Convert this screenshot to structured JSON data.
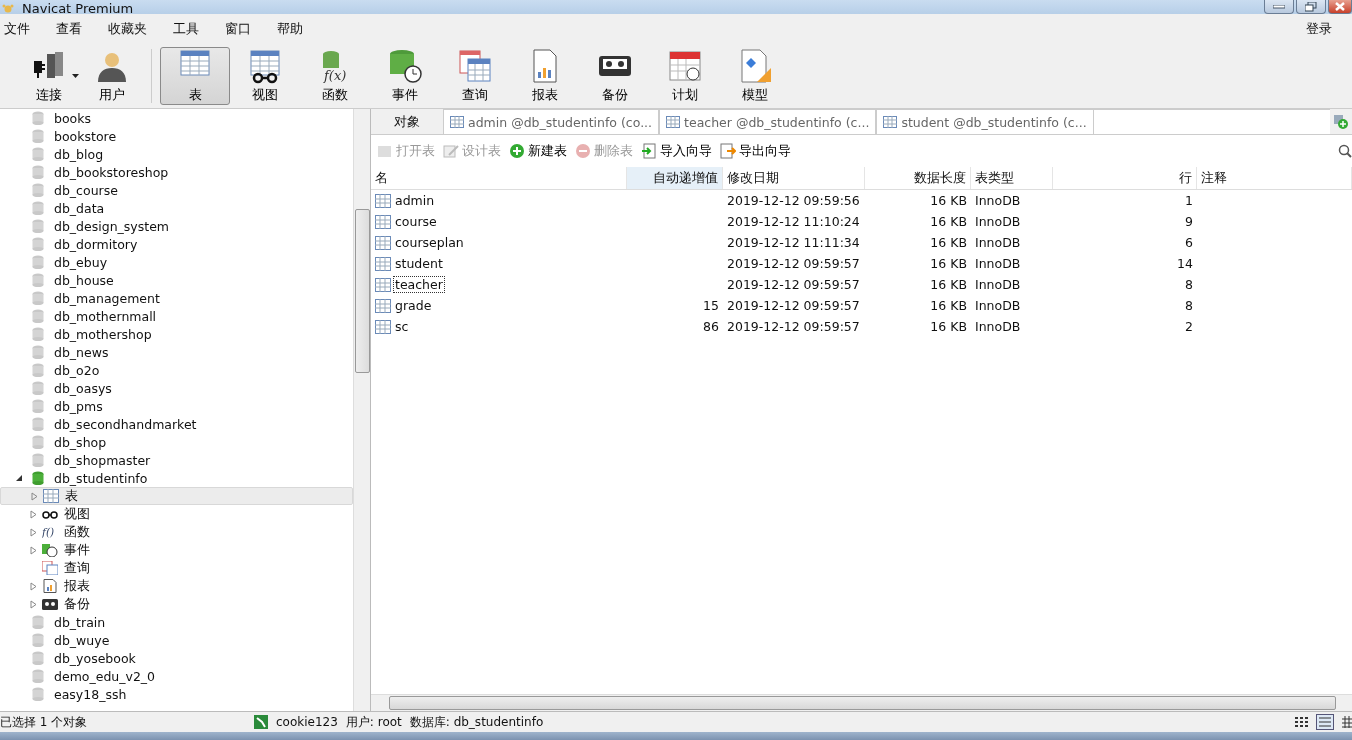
{
  "window": {
    "title": "Navicat Premium"
  },
  "menu": [
    "文件",
    "查看",
    "收藏夹",
    "工具",
    "窗口",
    "帮助"
  ],
  "login": "登录",
  "toolbar": [
    {
      "kind": "connection",
      "label": "连接",
      "selected": false
    },
    {
      "kind": "user",
      "label": "用户",
      "selected": false
    },
    {
      "kind": "table",
      "label": "表",
      "selected": true
    },
    {
      "kind": "view",
      "label": "视图",
      "selected": false
    },
    {
      "kind": "function",
      "label": "函数",
      "glyph": "f(x)",
      "selected": false
    },
    {
      "kind": "event",
      "label": "事件",
      "selected": false
    },
    {
      "kind": "query",
      "label": "查询",
      "selected": false
    },
    {
      "kind": "report",
      "label": "报表",
      "selected": false
    },
    {
      "kind": "backup",
      "label": "备份",
      "selected": false
    },
    {
      "kind": "schedule",
      "label": "计划",
      "selected": false
    },
    {
      "kind": "model",
      "label": "模型",
      "selected": false
    }
  ],
  "tree": [
    {
      "name": "books",
      "expanded": false
    },
    {
      "name": "bookstore",
      "expanded": false
    },
    {
      "name": "db_blog",
      "expanded": false
    },
    {
      "name": "db_bookstoreshop",
      "expanded": false
    },
    {
      "name": "db_course",
      "expanded": false
    },
    {
      "name": "db_data",
      "expanded": false
    },
    {
      "name": "db_design_system",
      "expanded": false
    },
    {
      "name": "db_dormitory",
      "expanded": false
    },
    {
      "name": "db_ebuy",
      "expanded": false
    },
    {
      "name": "db_house",
      "expanded": false
    },
    {
      "name": "db_management",
      "expanded": false
    },
    {
      "name": "db_mothernmall",
      "expanded": false
    },
    {
      "name": "db_mothershop",
      "expanded": false
    },
    {
      "name": "db_news",
      "expanded": false
    },
    {
      "name": "db_o2o",
      "expanded": false
    },
    {
      "name": "db_oasys",
      "expanded": false
    },
    {
      "name": "db_pms",
      "expanded": false
    },
    {
      "name": "db_secondhandmarket",
      "expanded": false
    },
    {
      "name": "db_shop",
      "expanded": false
    },
    {
      "name": "db_shopmaster",
      "expanded": false
    },
    {
      "name": "db_studentinfo",
      "expanded": true,
      "children": [
        {
          "kind": "table",
          "name": "表",
          "expandable": true,
          "selected": true
        },
        {
          "kind": "view",
          "name": "视图",
          "expandable": true,
          "selected": false
        },
        {
          "kind": "function",
          "name": "函数",
          "glyph": "f()",
          "expandable": true,
          "selected": false
        },
        {
          "kind": "event",
          "name": "事件",
          "expandable": true,
          "selected": false
        },
        {
          "kind": "query",
          "name": "查询",
          "expandable": false,
          "selected": false
        },
        {
          "kind": "report",
          "name": "报表",
          "expandable": true,
          "selected": false
        },
        {
          "kind": "backup",
          "name": "备份",
          "expandable": true,
          "selected": false
        }
      ]
    },
    {
      "name": "db_train",
      "expanded": false
    },
    {
      "name": "db_wuye",
      "expanded": false
    },
    {
      "name": "db_yosebook",
      "expanded": false
    },
    {
      "name": "demo_edu_v2_0",
      "expanded": false
    },
    {
      "name": "easy18_ssh",
      "expanded": false
    }
  ],
  "tabs": [
    {
      "label": "对象",
      "kind": "objects",
      "selected": true
    },
    {
      "label": "admin @db_studentinfo (co...",
      "kind": "table",
      "selected": false
    },
    {
      "label": "teacher @db_studentinfo (c...",
      "kind": "table",
      "selected": false
    },
    {
      "label": "student @db_studentinfo (c...",
      "kind": "table",
      "selected": false
    }
  ],
  "actions": [
    {
      "kind": "open",
      "label": "打开表",
      "disabled": true
    },
    {
      "kind": "design",
      "label": "设计表",
      "disabled": true
    },
    {
      "kind": "new",
      "label": "新建表",
      "disabled": false
    },
    {
      "kind": "delete",
      "label": "删除表",
      "disabled": true
    },
    {
      "kind": "import",
      "label": "导入向导",
      "disabled": false
    },
    {
      "kind": "export",
      "label": "导出向导",
      "disabled": false
    }
  ],
  "table": {
    "columns": [
      "名",
      "自动递增值",
      "修改日期",
      "数据长度",
      "表类型",
      "行",
      "注释"
    ],
    "rows": [
      {
        "name": "admin",
        "auto_increment": "",
        "modified": "2019-12-12 09:59:56",
        "size": "16 KB",
        "type": "InnoDB",
        "rows": "1",
        "focused": false
      },
      {
        "name": "course",
        "auto_increment": "",
        "modified": "2019-12-12 11:10:24",
        "size": "16 KB",
        "type": "InnoDB",
        "rows": "9",
        "focused": false
      },
      {
        "name": "courseplan",
        "auto_increment": "",
        "modified": "2019-12-12 11:11:34",
        "size": "16 KB",
        "type": "InnoDB",
        "rows": "6",
        "focused": false
      },
      {
        "name": "student",
        "auto_increment": "",
        "modified": "2019-12-12 09:59:57",
        "size": "16 KB",
        "type": "InnoDB",
        "rows": "14",
        "focused": false
      },
      {
        "name": "teacher",
        "auto_increment": "",
        "modified": "2019-12-12 09:59:57",
        "size": "16 KB",
        "type": "InnoDB",
        "rows": "8",
        "focused": true
      },
      {
        "name": "grade",
        "auto_increment": "15",
        "modified": "2019-12-12 09:59:57",
        "size": "16 KB",
        "type": "InnoDB",
        "rows": "8",
        "focused": false
      },
      {
        "name": "sc",
        "auto_increment": "86",
        "modified": "2019-12-12 09:59:57",
        "size": "16 KB",
        "type": "InnoDB",
        "rows": "2",
        "focused": false
      }
    ]
  },
  "status_bar": {
    "selection": "已选择 1 个对象",
    "connection": "cookie123",
    "user": "用户: root",
    "database": "数据库: db_studentinfo"
  }
}
